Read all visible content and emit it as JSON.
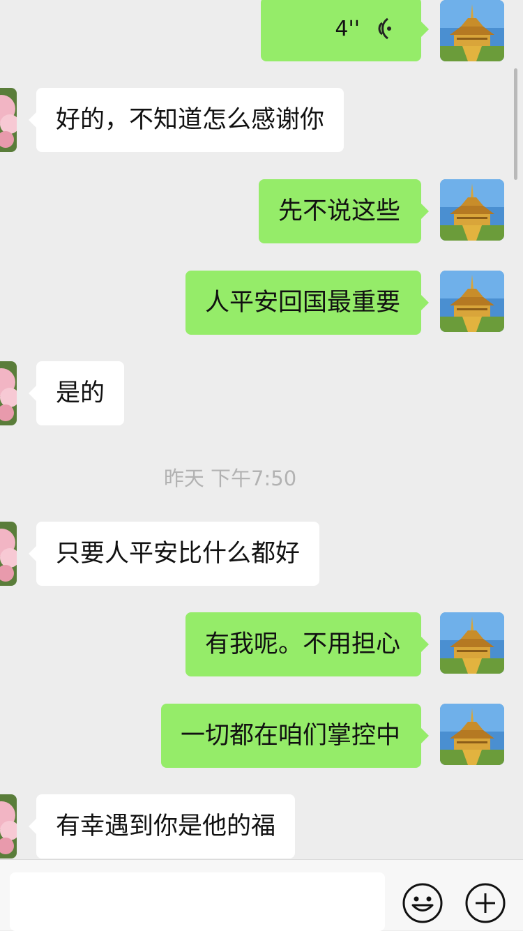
{
  "chat": {
    "messages": [
      {
        "side": "me",
        "type": "voice",
        "duration": "4''"
      },
      {
        "side": "other",
        "text": "好的，不知道怎么感谢你"
      },
      {
        "side": "me",
        "text": "先不说这些"
      },
      {
        "side": "me",
        "text": "人平安回国最重要"
      },
      {
        "side": "other",
        "text": "是的"
      },
      {
        "type": "time",
        "text": "昨天 下午7:50"
      },
      {
        "side": "other",
        "text": "只要人平安比什么都好"
      },
      {
        "side": "me",
        "text": "有我呢。不用担心"
      },
      {
        "side": "me",
        "text": "一切都在咱们掌控中"
      },
      {
        "side": "other",
        "text": "有幸遇到你是他的福"
      }
    ]
  },
  "colors": {
    "background": "#ededed",
    "my_bubble": "#95ec69",
    "their_bubble": "#ffffff",
    "timestamp": "#b2b2b2"
  },
  "icons": {
    "voice": "voice-wave-icon",
    "emoji": "emoji-icon",
    "more": "plus-icon"
  }
}
